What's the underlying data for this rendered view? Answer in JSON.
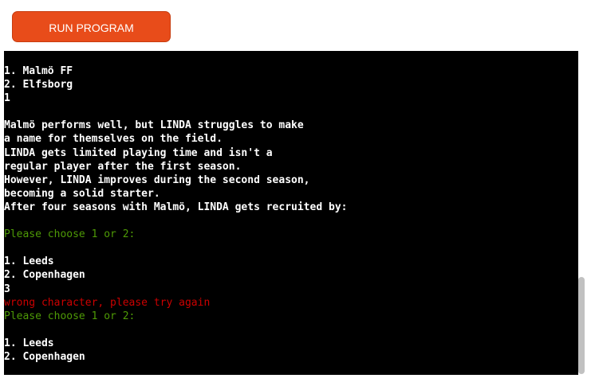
{
  "toolbar": {
    "run_label": "RUN PROGRAM"
  },
  "colors": {
    "button": "#e84c1a",
    "terminal_background": "#000000",
    "terminal_text": "#ffffff",
    "prompt_text": "#4e9a06",
    "error_text": "#cc0000"
  },
  "terminal": {
    "lines": [
      {
        "text": "1. Malmö FF",
        "kind": "output"
      },
      {
        "text": "2. Elfsborg",
        "kind": "output"
      },
      {
        "text": "1",
        "kind": "output"
      },
      {
        "text": "",
        "kind": "output"
      },
      {
        "text": "Malmö performs well, but LINDA struggles to make",
        "kind": "output"
      },
      {
        "text": "a name for themselves on the field.",
        "kind": "output"
      },
      {
        "text": "LINDA gets limited playing time and isn't a",
        "kind": "output"
      },
      {
        "text": "regular player after the first season.",
        "kind": "output"
      },
      {
        "text": "However, LINDA improves during the second season,",
        "kind": "output"
      },
      {
        "text": "becoming a solid starter.",
        "kind": "output"
      },
      {
        "text": "After four seasons with Malmö, LINDA gets recruited by:",
        "kind": "output"
      },
      {
        "text": "",
        "kind": "output"
      },
      {
        "text": "Please choose 1 or 2:",
        "kind": "prompt"
      },
      {
        "text": "",
        "kind": "output"
      },
      {
        "text": "1. Leeds",
        "kind": "output"
      },
      {
        "text": "2. Copenhagen",
        "kind": "output"
      },
      {
        "text": "3",
        "kind": "output"
      },
      {
        "text": "wrong character, please try again",
        "kind": "error"
      },
      {
        "text": "Please choose 1 or 2:",
        "kind": "prompt"
      },
      {
        "text": "",
        "kind": "output"
      },
      {
        "text": "1. Leeds",
        "kind": "output"
      },
      {
        "text": "2. Copenhagen",
        "kind": "output"
      }
    ]
  }
}
